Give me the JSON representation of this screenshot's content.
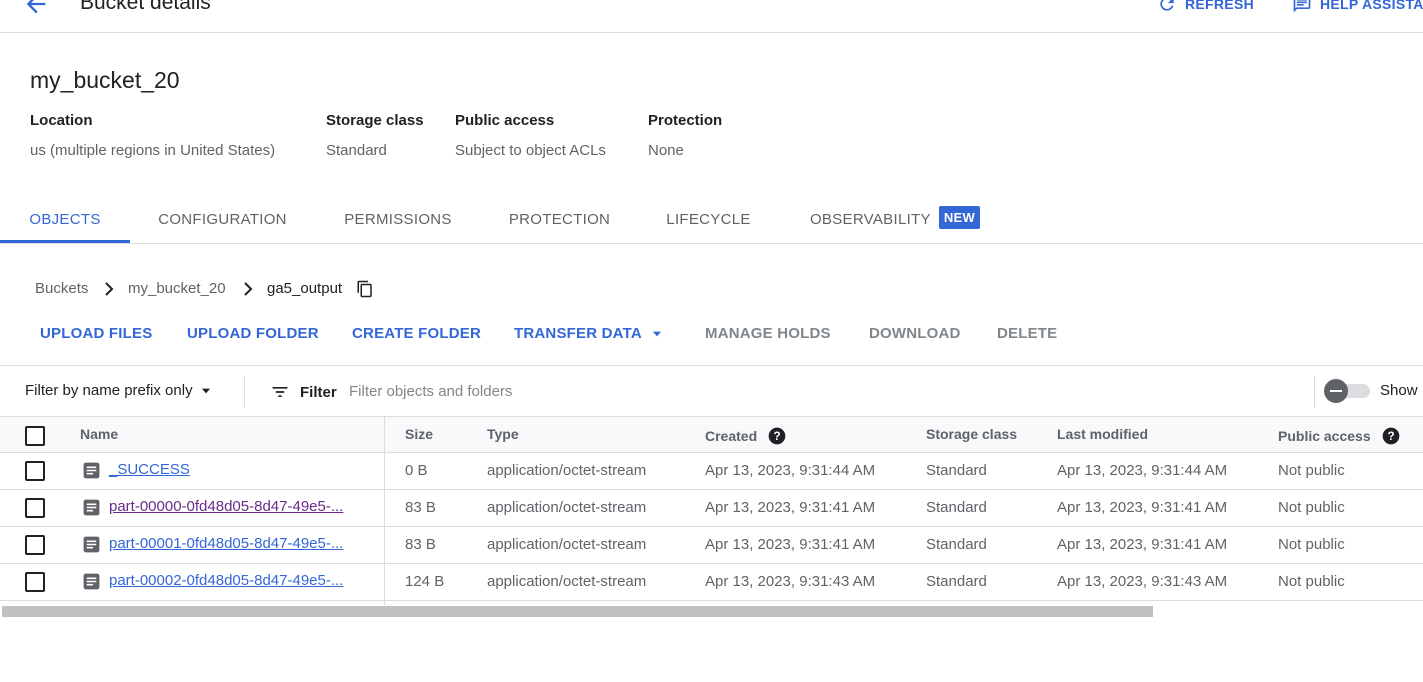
{
  "header": {
    "title": "Bucket details",
    "refresh_label": "REFRESH",
    "help_label": "HELP ASSISTA"
  },
  "bucket": {
    "name": "my_bucket_20",
    "meta": [
      {
        "label": "Location",
        "value": "us (multiple regions in United States)"
      },
      {
        "label": "Storage class",
        "value": "Standard"
      },
      {
        "label": "Public access",
        "value": "Subject to object ACLs"
      },
      {
        "label": "Protection",
        "value": "None"
      }
    ]
  },
  "tabs": [
    {
      "label": "OBJECTS",
      "active": true
    },
    {
      "label": "CONFIGURATION"
    },
    {
      "label": "PERMISSIONS"
    },
    {
      "label": "PROTECTION"
    },
    {
      "label": "LIFECYCLE"
    },
    {
      "label": "OBSERVABILITY",
      "badge": "NEW"
    }
  ],
  "breadcrumb": [
    "Buckets",
    "my_bucket_20",
    "ga5_output"
  ],
  "actions": {
    "upload_files": "UPLOAD FILES",
    "upload_folder": "UPLOAD FOLDER",
    "create_folder": "CREATE FOLDER",
    "transfer_data": "TRANSFER DATA",
    "manage_holds": "MANAGE HOLDS",
    "download": "DOWNLOAD",
    "delete": "DELETE"
  },
  "filter": {
    "mode": "Filter by name prefix only",
    "button_label": "Filter",
    "placeholder": "Filter objects and folders",
    "toggle_label": "Show"
  },
  "table": {
    "columns": [
      "Name",
      "Size",
      "Type",
      "Created",
      "Storage class",
      "Last modified",
      "Public access"
    ],
    "rows": [
      {
        "name": "_SUCCESS",
        "size": "0 B",
        "type": "application/octet-stream",
        "created": "Apr 13, 2023, 9:31:44 AM",
        "storage_class": "Standard",
        "last_modified": "Apr 13, 2023, 9:31:44 AM",
        "public_access": "Not public"
      },
      {
        "name": "part-00000-0fd48d05-8d47-49e5-...",
        "size": "83 B",
        "type": "application/octet-stream",
        "created": "Apr 13, 2023, 9:31:41 AM",
        "storage_class": "Standard",
        "last_modified": "Apr 13, 2023, 9:31:41 AM",
        "public_access": "Not public"
      },
      {
        "name": "part-00001-0fd48d05-8d47-49e5-...",
        "size": "83 B",
        "type": "application/octet-stream",
        "created": "Apr 13, 2023, 9:31:41 AM",
        "storage_class": "Standard",
        "last_modified": "Apr 13, 2023, 9:31:41 AM",
        "public_access": "Not public"
      },
      {
        "name": "part-00002-0fd48d05-8d47-49e5-...",
        "size": "124 B",
        "type": "application/octet-stream",
        "created": "Apr 13, 2023, 9:31:43 AM",
        "storage_class": "Standard",
        "last_modified": "Apr 13, 2023, 9:31:43 AM",
        "public_access": "Not public"
      }
    ]
  },
  "colors": {
    "accent": "#3367d6",
    "visited_link": "#6a2a8a",
    "muted_text": "#5f6368",
    "divider": "#dadce0"
  }
}
